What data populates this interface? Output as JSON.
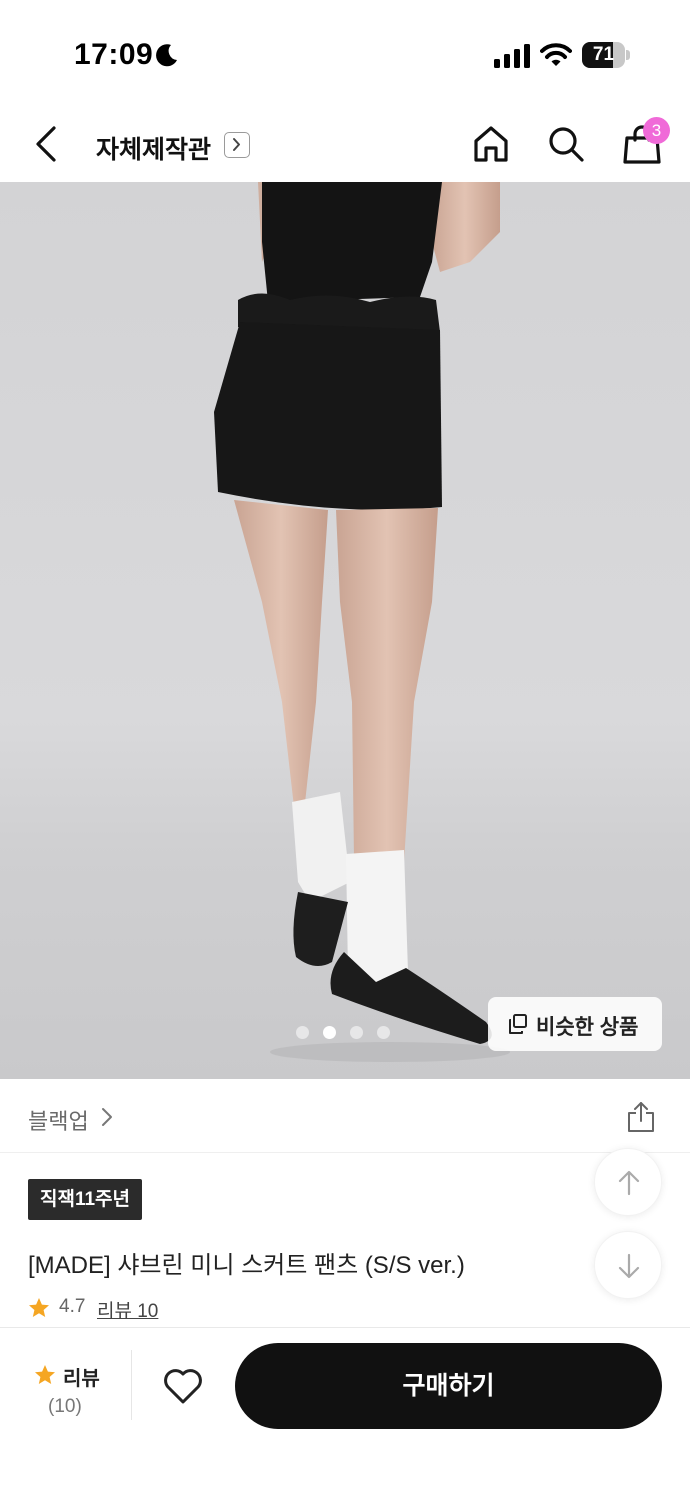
{
  "status_bar": {
    "time": "17:09",
    "battery": "71",
    "battery_level": 0.71,
    "icons": [
      "moon-icon",
      "signal-icon",
      "wifi-icon",
      "battery-icon"
    ]
  },
  "nav": {
    "title": "자체제작관",
    "cart_count": "3",
    "icons": [
      "back-icon",
      "chevron-right-icon",
      "home-icon",
      "search-icon",
      "shopping-bag-icon"
    ]
  },
  "gallery": {
    "dot_count": 4,
    "active_dot": 2,
    "similar_label": "비슷한 상품",
    "icons": [
      "copy-icon"
    ]
  },
  "brand": {
    "name": "블랙업",
    "icons": [
      "chevron-right-icon",
      "share-icon"
    ]
  },
  "product": {
    "tag": "직잭11주년",
    "title": "[MADE] 샤브린 미니 스커트 팬츠 (S/S ver.)",
    "rating": "4.7",
    "review_link": "리뷰 10",
    "icons": [
      "star-icon"
    ]
  },
  "floating": {
    "icons": [
      "arrow-up-icon",
      "arrow-down-icon"
    ]
  },
  "bottom_bar": {
    "review_label": "리뷰",
    "review_count": "(10)",
    "buy_label": "구매하기",
    "icons": [
      "star-icon",
      "heart-icon"
    ]
  },
  "colors": {
    "badge": "#f06ad8",
    "star": "#f5a623",
    "buy_button": "#111111",
    "tag_bg": "#2b2b2b"
  }
}
